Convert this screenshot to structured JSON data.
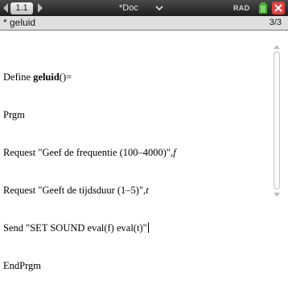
{
  "titlebar": {
    "tab_label": "1.1",
    "doc_title": "*Doc",
    "angle_mode": "RAD"
  },
  "entry": {
    "name": "* geluid",
    "count": "3/3"
  },
  "program": {
    "line1_kw": "Define ",
    "line1_name": "geluid",
    "line1_tail": "()=",
    "line2": "Prgm",
    "line3_cmd": "Request \"Geef de frequentie (100–4000)\",",
    "line3_var": "f",
    "line4_cmd": "Request \"Geeft de tijdsduur (1–5)\",",
    "line4_var": "t",
    "line5": "Send \"SET SOUND eval(f) eval(t)\"",
    "line6": "EndPrgm"
  },
  "colors": {
    "titlebar": "#2a2a2a",
    "close_button": "#e04040",
    "battery": "#4cae3c"
  },
  "icons": {
    "nav_left": "triangle-left-icon",
    "nav_right": "triangle-right-icon",
    "doc_menu": "chevron-down-icon",
    "battery": "battery-icon",
    "close": "close-icon"
  }
}
